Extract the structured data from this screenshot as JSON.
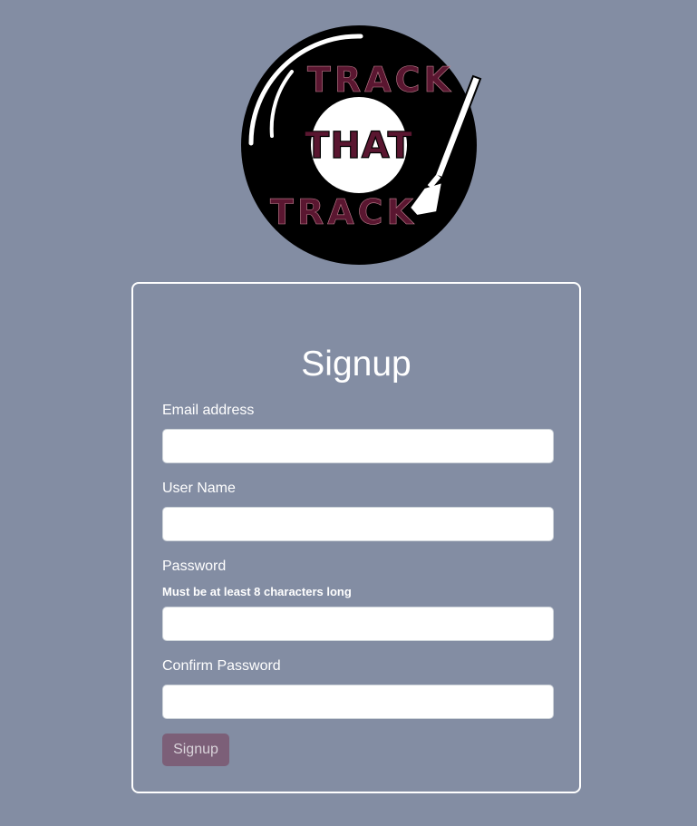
{
  "logo": {
    "top_word": "TRACK",
    "middle_word": "THAT",
    "bottom_word": "TRACK",
    "accent_color": "#5a1630"
  },
  "form": {
    "title": "Signup",
    "email_label": "Email address",
    "email_value": "",
    "username_label": "User Name",
    "username_value": "",
    "password_label": "Password",
    "password_hint": "Must be at least 8 characters long",
    "password_value": "",
    "confirm_label": "Confirm Password",
    "confirm_value": "",
    "submit_label": "Signup"
  },
  "colors": {
    "background": "#838da3",
    "button": "#7c5f78"
  }
}
